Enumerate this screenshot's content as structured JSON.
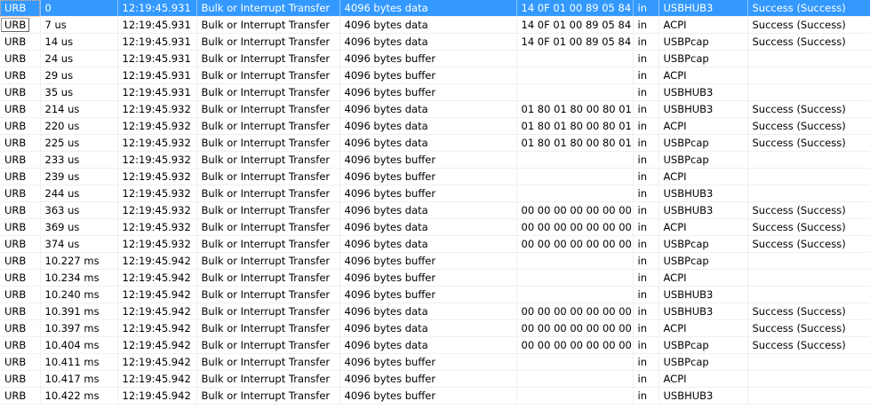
{
  "columns_hint": "log",
  "rows": [
    [
      "URB",
      "0",
      "12:19:45.931",
      "Bulk or Interrupt Transfer",
      "4096 bytes data",
      "14 0F 01 00 89 05 84 ...",
      "in",
      "USBHUB3",
      "Success (Success)"
    ],
    [
      "URB",
      "7 us",
      "12:19:45.931",
      "Bulk or Interrupt Transfer",
      "4096 bytes data",
      "14 0F 01 00 89 05 84 ...",
      "in",
      "ACPI",
      "Success (Success)"
    ],
    [
      "URB",
      "14 us",
      "12:19:45.931",
      "Bulk or Interrupt Transfer",
      "4096 bytes data",
      "14 0F 01 00 89 05 84 ...",
      "in",
      "USBPcap",
      "Success (Success)"
    ],
    [
      "URB",
      "24 us",
      "12:19:45.931",
      "Bulk or Interrupt Transfer",
      "4096 bytes buffer",
      "",
      "in",
      "USBPcap",
      ""
    ],
    [
      "URB",
      "29 us",
      "12:19:45.931",
      "Bulk or Interrupt Transfer",
      "4096 bytes buffer",
      "",
      "in",
      "ACPI",
      ""
    ],
    [
      "URB",
      "35 us",
      "12:19:45.931",
      "Bulk or Interrupt Transfer",
      "4096 bytes buffer",
      "",
      "in",
      "USBHUB3",
      ""
    ],
    [
      "URB",
      "214 us",
      "12:19:45.932",
      "Bulk or Interrupt Transfer",
      "4096 bytes data",
      "01 80 01 80 00 80 01 ...",
      "in",
      "USBHUB3",
      "Success (Success)"
    ],
    [
      "URB",
      "220 us",
      "12:19:45.932",
      "Bulk or Interrupt Transfer",
      "4096 bytes data",
      "01 80 01 80 00 80 01 ...",
      "in",
      "ACPI",
      "Success (Success)"
    ],
    [
      "URB",
      "225 us",
      "12:19:45.932",
      "Bulk or Interrupt Transfer",
      "4096 bytes data",
      "01 80 01 80 00 80 01 ...",
      "in",
      "USBPcap",
      "Success (Success)"
    ],
    [
      "URB",
      "233 us",
      "12:19:45.932",
      "Bulk or Interrupt Transfer",
      "4096 bytes buffer",
      "",
      "in",
      "USBPcap",
      ""
    ],
    [
      "URB",
      "239 us",
      "12:19:45.932",
      "Bulk or Interrupt Transfer",
      "4096 bytes buffer",
      "",
      "in",
      "ACPI",
      ""
    ],
    [
      "URB",
      "244 us",
      "12:19:45.932",
      "Bulk or Interrupt Transfer",
      "4096 bytes buffer",
      "",
      "in",
      "USBHUB3",
      ""
    ],
    [
      "URB",
      "363 us",
      "12:19:45.932",
      "Bulk or Interrupt Transfer",
      "4096 bytes data",
      "00 00 00 00 00 00 00 ...",
      "in",
      "USBHUB3",
      "Success (Success)"
    ],
    [
      "URB",
      "369 us",
      "12:19:45.932",
      "Bulk or Interrupt Transfer",
      "4096 bytes data",
      "00 00 00 00 00 00 00 ...",
      "in",
      "ACPI",
      "Success (Success)"
    ],
    [
      "URB",
      "374 us",
      "12:19:45.932",
      "Bulk or Interrupt Transfer",
      "4096 bytes data",
      "00 00 00 00 00 00 00 ...",
      "in",
      "USBPcap",
      "Success (Success)"
    ],
    [
      "URB",
      "10.227 ms",
      "12:19:45.942",
      "Bulk or Interrupt Transfer",
      "4096 bytes buffer",
      "",
      "in",
      "USBPcap",
      ""
    ],
    [
      "URB",
      "10.234 ms",
      "12:19:45.942",
      "Bulk or Interrupt Transfer",
      "4096 bytes buffer",
      "",
      "in",
      "ACPI",
      ""
    ],
    [
      "URB",
      "10.240 ms",
      "12:19:45.942",
      "Bulk or Interrupt Transfer",
      "4096 bytes buffer",
      "",
      "in",
      "USBHUB3",
      ""
    ],
    [
      "URB",
      "10.391 ms",
      "12:19:45.942",
      "Bulk or Interrupt Transfer",
      "4096 bytes data",
      "00 00 00 00 00 00 00 ...",
      "in",
      "USBHUB3",
      "Success (Success)"
    ],
    [
      "URB",
      "10.397 ms",
      "12:19:45.942",
      "Bulk or Interrupt Transfer",
      "4096 bytes data",
      "00 00 00 00 00 00 00 ...",
      "in",
      "ACPI",
      "Success (Success)"
    ],
    [
      "URB",
      "10.404 ms",
      "12:19:45.942",
      "Bulk or Interrupt Transfer",
      "4096 bytes data",
      "00 00 00 00 00 00 00 ...",
      "in",
      "USBPcap",
      "Success (Success)"
    ],
    [
      "URB",
      "10.411 ms",
      "12:19:45.942",
      "Bulk or Interrupt Transfer",
      "4096 bytes buffer",
      "",
      "in",
      "USBPcap",
      ""
    ],
    [
      "URB",
      "10.417 ms",
      "12:19:45.942",
      "Bulk or Interrupt Transfer",
      "4096 bytes buffer",
      "",
      "in",
      "ACPI",
      ""
    ],
    [
      "URB",
      "10.422 ms",
      "12:19:45.942",
      "Bulk or Interrupt Transfer",
      "4096 bytes buffer",
      "",
      "in",
      "USBHUB3",
      ""
    ]
  ],
  "selected_row": 0,
  "tooltip_row": 1,
  "colors": {
    "selection": "#3399ff"
  }
}
